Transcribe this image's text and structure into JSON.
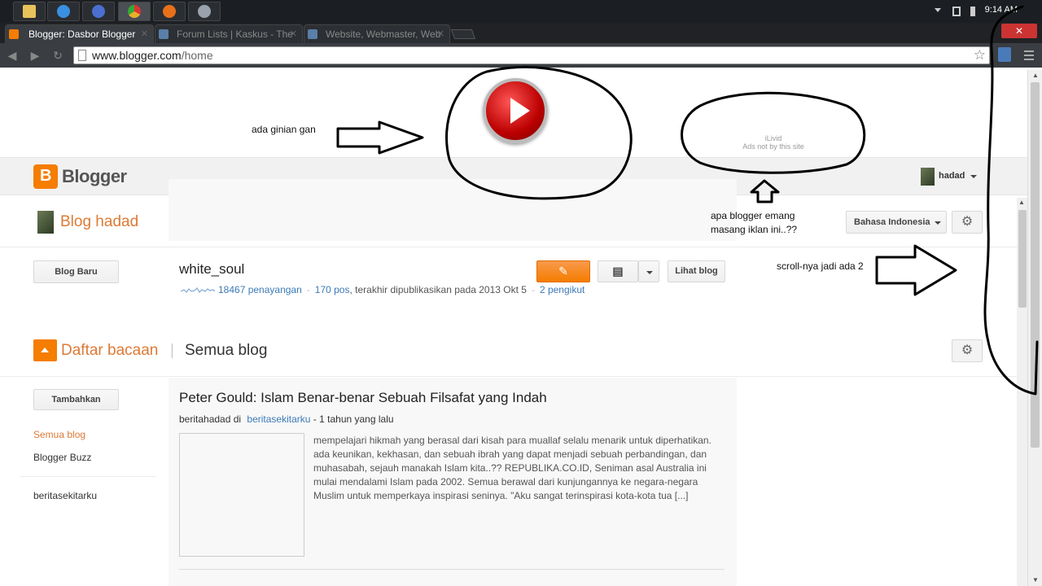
{
  "taskbar": {
    "apps": [
      {
        "icon": "folder-icon",
        "color": "#e8c25a"
      },
      {
        "icon": "ie-icon",
        "color": "#3a8fe0"
      },
      {
        "icon": "network-icon",
        "color": "#4a6fd0"
      },
      {
        "icon": "chrome-icon",
        "color": "#e8b02a"
      },
      {
        "icon": "firefox-icon",
        "color": "#e8701a"
      },
      {
        "icon": "tool-icon",
        "color": "#9aa3ad"
      }
    ],
    "clock": "9:14 AM"
  },
  "browser": {
    "tabs": [
      {
        "title": "Blogger: Dasbor Blogger",
        "favicon": "blogger-icon",
        "active": true
      },
      {
        "title": "Forum Lists | Kaskus - The",
        "favicon": "kaskus-icon",
        "active": false
      },
      {
        "title": "Website, Webmaster, Web",
        "favicon": "kaskus-icon",
        "active": false
      }
    ],
    "close_label": "✕",
    "url_host": "www.blogger.com",
    "url_path": "/home"
  },
  "ad": {
    "ilivid_text": "iLivid",
    "ads_text": "Ads not by this site"
  },
  "header": {
    "logo": "Blogger",
    "user_name": "hadad"
  },
  "blog_header": {
    "title": "Blog hadad",
    "language": "Bahasa Indonesia"
  },
  "blog_list": {
    "new_blog_label": "Blog Baru",
    "blogs": [
      {
        "name": "white_soul",
        "views": "18467 penayangan",
        "posts": "170 pos",
        "last_published": ", terakhir dipublikasikan pada 2013 Okt 5",
        "followers": "2 pengikut",
        "view_label": "Lihat blog"
      }
    ]
  },
  "reading_list": {
    "title": "Daftar bacaan",
    "separator": "|",
    "subtitle": "Semua blog",
    "add_label": "Tambahkan",
    "sidebar": [
      {
        "label": "Semua blog",
        "active": true
      },
      {
        "label": "Blogger Buzz",
        "active": false
      },
      {
        "label": "beritasekitarku",
        "active": false
      }
    ],
    "post": {
      "title": "Peter Gould: Islam Benar-benar Sebuah Filsafat yang Indah",
      "author": "beritahadad di",
      "blog": "beritasekitarku",
      "time": "- 1 tahun yang lalu",
      "snippet_lines": [
        "mempelajari hikmah yang berasal dari kisah para muallaf selalu menarik untuk diperhatikan.",
        "ada keunikan, kekhasan, dan sebuah ibrah yang dapat menjadi sebuah perbandingan, dan",
        "muhasabah, sejauh manakah Islam kita..?? REPUBLIKA.CO.ID, Seniman asal Australia ini",
        "mulai mendalami Islam pada 2002. Semua berawal dari kunjungannya ke negara-negara",
        "Muslim untuk memperkaya inspirasi seninya. \"Aku sangat terinspirasi kota-kota tua [...]"
      ]
    }
  },
  "annotations": {
    "note1": "ada ginian gan",
    "note2_line1": "apa blogger emang",
    "note2_line2": "masang iklan ini..??",
    "note3": "scroll-nya jadi ada 2"
  },
  "colors": {
    "accent": "#f57d00",
    "title_orange": "#dd7a35",
    "link": "#3d7ab8"
  }
}
